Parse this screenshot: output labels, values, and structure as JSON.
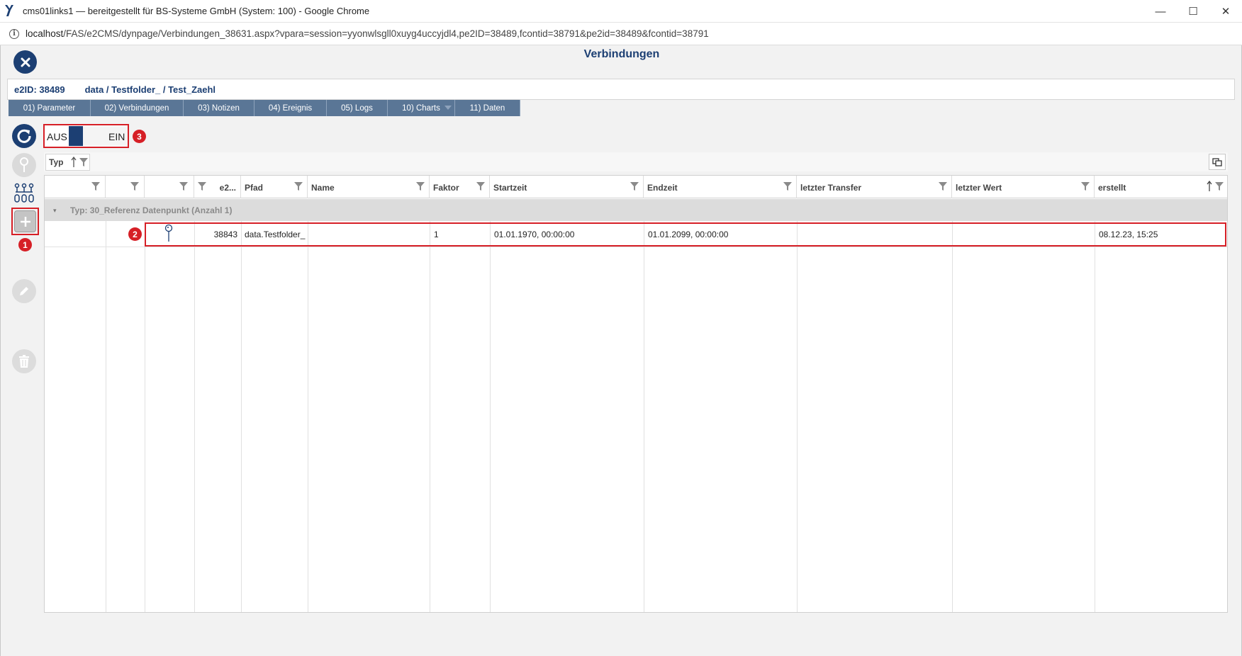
{
  "window": {
    "title": "cms01links1 — bereitgestellt für BS-Systeme GmbH (System: 100) - Google Chrome",
    "minimize_glyph": "—",
    "maximize_glyph": "☐",
    "close_glyph": "✕"
  },
  "address": {
    "host": "localhost",
    "rest": "/FAS/e2CMS/dynpage/Verbindungen_38631.aspx?vpara=session=yyonwlsgll0xuyg4uccyjdl4,pe2ID=38489,fcontid=38791&pe2id=38489&fcontid=38791"
  },
  "page": {
    "title": "Verbindungen",
    "e2id": "e2ID: 38489",
    "path": "data / Testfolder_ / Test_Zaehl"
  },
  "tabs": [
    {
      "label": "01) Parameter"
    },
    {
      "label": "02) Verbindungen"
    },
    {
      "label": "03) Notizen"
    },
    {
      "label": "04) Ereignis"
    },
    {
      "label": "05) Logs"
    },
    {
      "label": "10) Charts"
    },
    {
      "label": "11) Daten"
    }
  ],
  "toggle": {
    "off_label": "AUS",
    "on_label": "EIN"
  },
  "badges": {
    "one": "1",
    "two": "2",
    "three": "3"
  },
  "grouping": {
    "chip_label": "Typ"
  },
  "grid": {
    "columns": {
      "e2": "e2...",
      "pfad": "Pfad",
      "name": "Name",
      "faktor": "Faktor",
      "startzeit": "Startzeit",
      "endzeit": "Endzeit",
      "letzter_transfer": "letzter Transfer",
      "letzter_wert": "letzter Wert",
      "erstellt": "erstellt"
    },
    "group_row": "Typ: 30_Referenz Datenpunkt (Anzahl 1)",
    "rows": [
      {
        "e2": "38843",
        "pfad": "data.Testfolder_",
        "name": "",
        "faktor": "1",
        "startzeit": "01.01.1970, 00:00:00",
        "endzeit": "01.01.2099, 00:00:00",
        "letzter_transfer": "",
        "letzter_wert": "",
        "erstellt": "08.12.23, 15:25"
      }
    ]
  },
  "colors": {
    "brand": "#1c3f73",
    "tab": "#5a7696",
    "highlight": "#d61f26"
  }
}
